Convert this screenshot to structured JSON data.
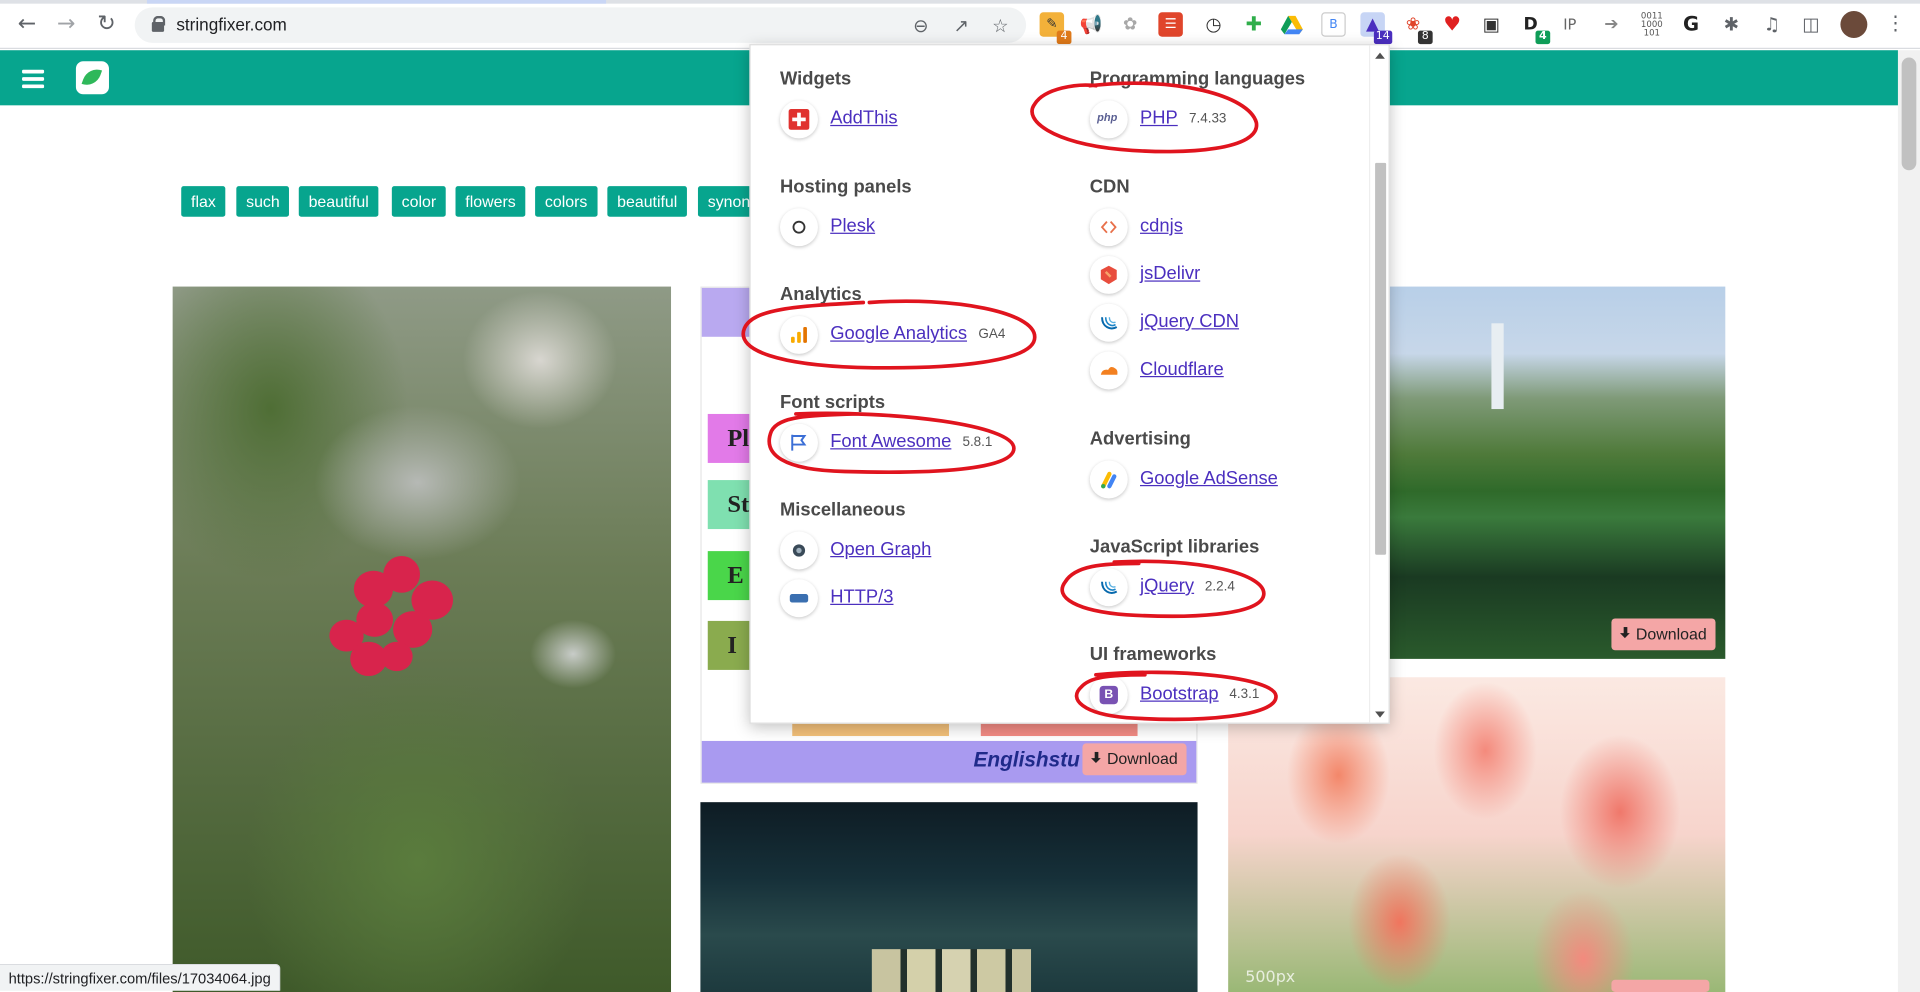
{
  "browser": {
    "url": "stringfixer.com",
    "status_url": "https://stringfixer.com/files/17034064.jpg",
    "extension_badges": {
      "ext1": "4",
      "wappalyzer": "14",
      "ext_gift": "8",
      "ext_d": "4"
    }
  },
  "page": {
    "tags": [
      "flax",
      "such",
      "beautiful",
      "color",
      "flowers",
      "colors",
      "beautiful",
      "synony"
    ],
    "download_label": "Download",
    "middle_card": {
      "bars": [
        "Pl",
        "St",
        "E",
        "I"
      ],
      "brand": "Englishstu"
    },
    "tulips_watermark": "500px"
  },
  "popup": {
    "categories": [
      {
        "name": "Widgets",
        "items": [
          {
            "name": "AddThis",
            "version": ""
          }
        ]
      },
      {
        "name": "Hosting panels",
        "items": [
          {
            "name": "Plesk",
            "version": ""
          }
        ]
      },
      {
        "name": "Analytics",
        "items": [
          {
            "name": "Google Analytics",
            "version": "GA4"
          }
        ]
      },
      {
        "name": "Font scripts",
        "items": [
          {
            "name": "Font Awesome",
            "version": "5.8.1"
          }
        ]
      },
      {
        "name": "Miscellaneous",
        "items": [
          {
            "name": "Open Graph",
            "version": ""
          },
          {
            "name": "HTTP/3",
            "version": ""
          }
        ]
      },
      {
        "name": "Programming languages",
        "items": [
          {
            "name": "PHP",
            "version": "7.4.33"
          }
        ]
      },
      {
        "name": "CDN",
        "items": [
          {
            "name": "cdnjs",
            "version": ""
          },
          {
            "name": "jsDelivr",
            "version": ""
          },
          {
            "name": "jQuery CDN",
            "version": ""
          },
          {
            "name": "Cloudflare",
            "version": ""
          }
        ]
      },
      {
        "name": "Advertising",
        "items": [
          {
            "name": "Google AdSense",
            "version": ""
          }
        ]
      },
      {
        "name": "JavaScript libraries",
        "items": [
          {
            "name": "jQuery",
            "version": "2.2.4"
          }
        ]
      },
      {
        "name": "UI frameworks",
        "items": [
          {
            "name": "Bootstrap",
            "version": "4.3.1"
          }
        ]
      }
    ],
    "icon_labels": {
      "php": "php",
      "bootstrap": "B"
    }
  },
  "colors": {
    "brand_teal": "#07a58e",
    "link_purple": "#4b2fbf",
    "annotation_red": "#e0141e"
  }
}
